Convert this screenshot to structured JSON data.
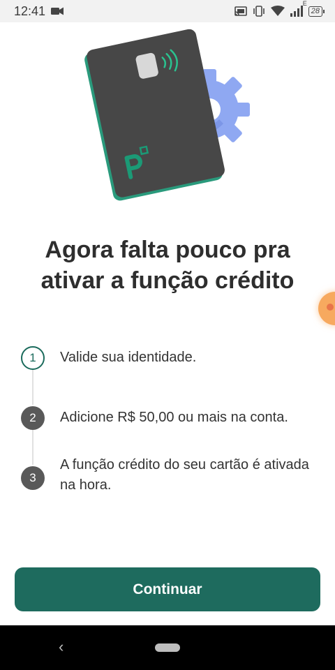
{
  "status_bar": {
    "time": "12:41",
    "network_letter": "E",
    "battery": "28",
    "icons": [
      "video-record-icon",
      "cast-icon",
      "vibrate-icon",
      "wifi-icon",
      "signal-icon",
      "battery-icon"
    ]
  },
  "hero": {
    "illustration": "credit-card-with-gear",
    "card_color": "#474747",
    "card_edge_color": "#2a9a7c",
    "gear_color": "#8fa8f2"
  },
  "title": {
    "line1": "Agora falta pouco pra",
    "line2": "ativar a função crédito"
  },
  "steps": [
    {
      "number": "1",
      "text": "Valide sua identidade.",
      "state": "active"
    },
    {
      "number": "2",
      "text": "Adicione R$ 50,00 ou mais na conta.",
      "state": "done"
    },
    {
      "number": "3",
      "text": "A função crédito do seu cartão é ativada na hora.",
      "state": "done"
    }
  ],
  "cta": {
    "label": "Continuar",
    "color": "#1e6b5e"
  },
  "nav": {
    "back_icon": "chevron-left-icon",
    "home_icon": "home-pill-icon"
  }
}
